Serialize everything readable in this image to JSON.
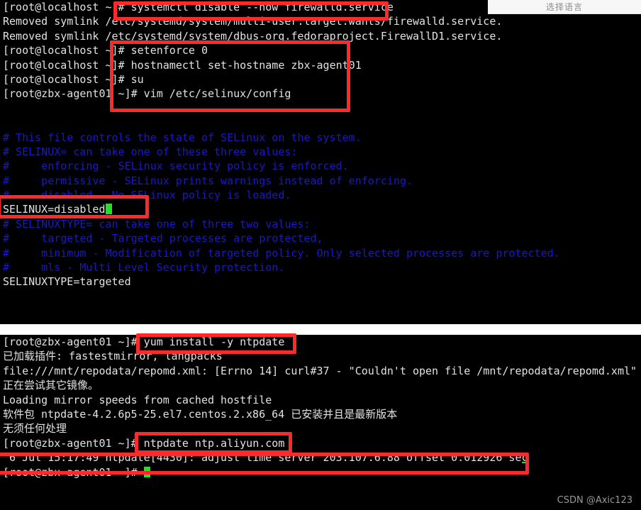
{
  "overlay": {
    "language_selector_label": "选择语言"
  },
  "watermark": {
    "text": "CSDN @Axic123"
  },
  "colors": {
    "terminal_background": "#000000",
    "terminal_foreground": "#d8d8d8",
    "comment_blue": "#1919c8",
    "cursor_green": "#22e322",
    "annotation_red": "#fb2b2b",
    "page_background": "#ffffff"
  },
  "terminal_top": {
    "lines": [
      {
        "id": "line-systemctl",
        "text": "[root@localhost ~]# systemctl disable --now firewalld.service",
        "color": "white"
      },
      {
        "id": "line-removed-1",
        "text": "Removed symlink /etc/systemd/system/multi-user.target.wants/firewalld.service.",
        "color": "white"
      },
      {
        "id": "line-removed-2",
        "text": "Removed symlink /etc/systemd/system/dbus-org.fedoraproject.FirewallD1.service.",
        "color": "white"
      },
      {
        "id": "line-setenforce",
        "text": "[root@localhost ~]# setenforce 0",
        "color": "white"
      },
      {
        "id": "line-hostnamectl",
        "text": "[root@localhost ~]# hostnamectl set-hostname zbx-agent01",
        "color": "white"
      },
      {
        "id": "line-su",
        "text": "[root@localhost ~]# su",
        "color": "white"
      },
      {
        "id": "line-vim",
        "text": "[root@zbx-agent01 ~]# vim /etc/selinux/config",
        "color": "white"
      },
      {
        "id": "line-gap-1",
        "text": "",
        "color": "white"
      },
      {
        "id": "line-gap-2",
        "text": "",
        "color": "white"
      },
      {
        "id": "line-cfg-1",
        "text": "# This file controls the state of SELinux on the system.",
        "color": "blue"
      },
      {
        "id": "line-cfg-2",
        "text": "# SELINUX= can take one of these three values:",
        "color": "blue"
      },
      {
        "id": "line-cfg-3",
        "text": "#     enforcing - SELinux security policy is enforced.",
        "color": "blue"
      },
      {
        "id": "line-cfg-4",
        "text": "#     permissive - SELinux prints warnings instead of enforcing.",
        "color": "blue"
      },
      {
        "id": "line-cfg-5",
        "text": "#     disabled - No SELinux policy is loaded.",
        "color": "blue"
      },
      {
        "id": "line-cfg-6",
        "text": "SELINUX=disabled",
        "color": "white",
        "cursor": true
      },
      {
        "id": "line-cfg-7",
        "text": "# SELINUXTYPE= can take one of three two values:",
        "color": "blue"
      },
      {
        "id": "line-cfg-8",
        "text": "#     targeted - Targeted processes are protected,",
        "color": "blue"
      },
      {
        "id": "line-cfg-9",
        "text": "#     minimum - Modification of targeted policy. Only selected processes are protected.",
        "color": "blue"
      },
      {
        "id": "line-cfg-10",
        "text": "#     mls - Multi Level Security protection.",
        "color": "blue"
      },
      {
        "id": "line-cfg-11",
        "text": "SELINUXTYPE=targeted",
        "color": "white"
      },
      {
        "id": "line-cfg-12",
        "text": "",
        "color": "blue"
      },
      {
        "id": "line-cfg-13",
        "text": "",
        "color": "blue"
      },
      {
        "id": "line-tilde",
        "text": "~",
        "color": "blue"
      }
    ]
  },
  "terminal_bottom": {
    "lines": [
      {
        "id": "line-yum",
        "text": "[root@zbx-agent01 ~]# yum install -y ntpdate",
        "color": "white"
      },
      {
        "id": "line-plugins",
        "text": "已加载插件: fastestmirror, langpacks",
        "color": "white"
      },
      {
        "id": "line-errno",
        "text": "file:///mnt/repodata/repomd.xml: [Errno 14] curl#37 - \"Couldn't open file /mnt/repodata/repomd.xml\"",
        "color": "white"
      },
      {
        "id": "line-trying",
        "text": "正在尝试其它镜像。",
        "color": "white"
      },
      {
        "id": "line-loading",
        "text": "Loading mirror speeds from cached hostfile",
        "color": "white"
      },
      {
        "id": "line-package",
        "text": "软件包 ntpdate-4.2.6p5-25.el7.centos.2.x86_64 已安装并且是最新版本",
        "color": "white"
      },
      {
        "id": "line-nothing",
        "text": "无须任何处理",
        "color": "white"
      },
      {
        "id": "line-ntpdate",
        "text": "[root@zbx-agent01 ~]# ntpdate ntp.aliyun.com",
        "color": "white"
      },
      {
        "id": "line-ntpresult",
        "text": " 6 Jul 15:17:49 ntpdate[4430]: adjust time server 203.107.6.88 offset 0.012926 sec",
        "color": "white",
        "underline_cursor": true
      },
      {
        "id": "line-prompt-end",
        "text": "[root@zbx-agent01 ~]# ",
        "color": "white",
        "cursor": true
      }
    ]
  },
  "annotations": {
    "boxes": [
      {
        "id": "redbox-systemctl",
        "label": "systemctl disable --now firewalld.service"
      },
      {
        "id": "redbox-cmds",
        "label": "setenforce / hostnamectl / su / vim commands"
      },
      {
        "id": "redbox-selinux",
        "label": "SELINUX=disabled"
      },
      {
        "id": "redbox-yum",
        "label": "yum install -y ntpdate"
      },
      {
        "id": "redbox-ntpdate",
        "label": "ntpdate ntp.aliyun.com"
      },
      {
        "id": "redbox-ntpout",
        "label": "ntpdate adjust time server output"
      }
    ]
  }
}
